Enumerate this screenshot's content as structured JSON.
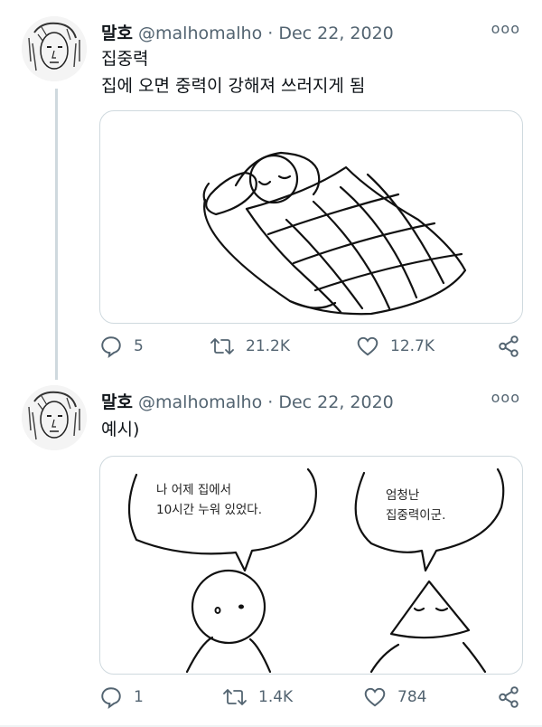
{
  "tweets": [
    {
      "display_name": "말호",
      "handle": "@malhomalho",
      "separator": "·",
      "date": "Dec 22, 2020",
      "more": "ooo",
      "text": "집중력\n집에 오면 중력이 강해져 쓰러지게 됨",
      "counts": {
        "replies": "5",
        "retweets": "21.2K",
        "likes": "12.7K"
      }
    },
    {
      "display_name": "말호",
      "handle": "@malhomalho",
      "separator": "·",
      "date": "Dec 22, 2020",
      "more": "ooo",
      "text": "예시)",
      "media": {
        "bubble_left": "나 어제 집에서\n10시간 누워 있었다.",
        "bubble_right": "엄청난\n집중력이군."
      },
      "counts": {
        "replies": "1",
        "retweets": "1.4K",
        "likes": "784"
      }
    }
  ],
  "icons": {
    "reply": "reply-icon",
    "retweet": "retweet-icon",
    "like": "heart-icon",
    "share": "share-icon",
    "more": "more-options-icon"
  },
  "colors": {
    "text": "#0f1419",
    "muted": "#536471",
    "border": "#cfd9de"
  }
}
